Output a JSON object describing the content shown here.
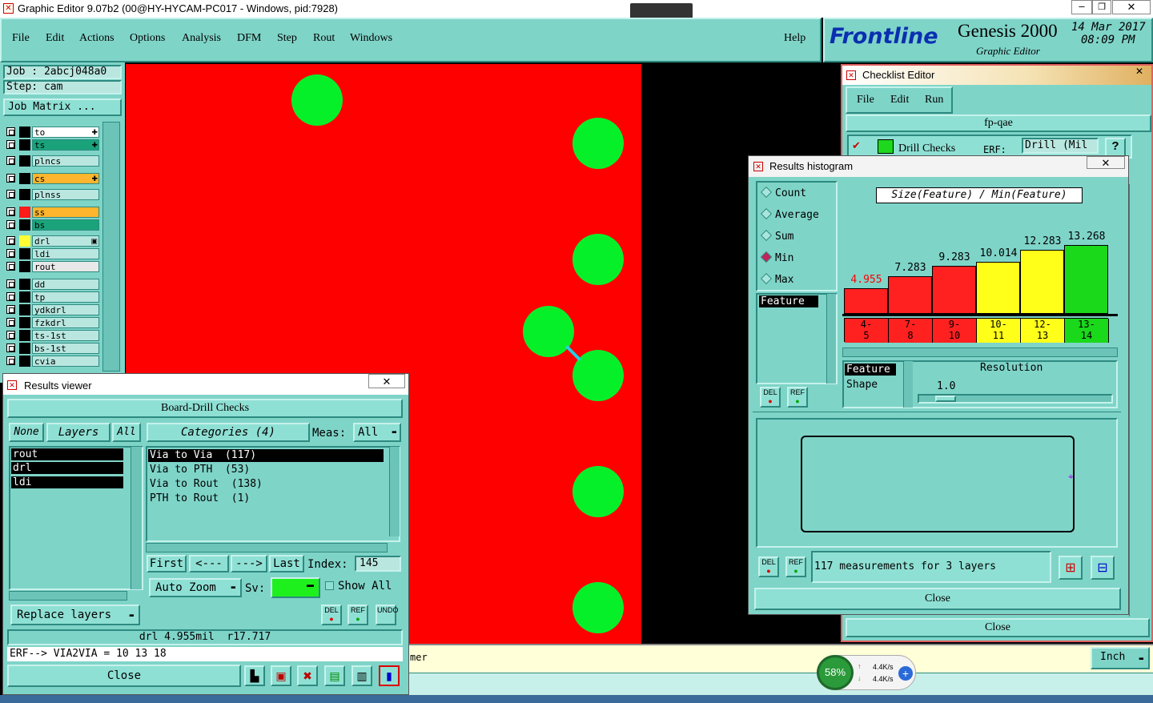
{
  "window": {
    "title": "Graphic Editor 9.07b2 (00@HY-HYCAM-PC017 - Windows, pid:7928)"
  },
  "menu": {
    "items": [
      "File",
      "Edit",
      "Actions",
      "Options",
      "Analysis",
      "DFM",
      "Step",
      "Rout",
      "Windows"
    ],
    "help": "Help"
  },
  "brand": {
    "logo": "Frontline",
    "product": "Genesis 2000",
    "subtitle": "Graphic Editor",
    "date": "14 Mar 2017",
    "time": "08:09 PM"
  },
  "job": {
    "job_label": "Job : 2abcj048a0",
    "step_label": "Step: cam",
    "matrix_button": "Job Matrix ..."
  },
  "layers": [
    {
      "name": "to",
      "color": "#000000",
      "name_bg": "#ffffff",
      "mark": "✚"
    },
    {
      "name": "ts",
      "color": "#000000",
      "name_bg": "#1aa37a",
      "mark": "✚"
    },
    {
      "name": "plncs",
      "color": "#000000",
      "name_bg": "#b9e7e0",
      "mark": ""
    },
    {
      "name": "cs",
      "color": "#000000",
      "name_bg": "#ffb52e",
      "mark": "✚"
    },
    {
      "name": "plnss",
      "color": "#000000",
      "name_bg": "#b9e7e0",
      "mark": ""
    },
    {
      "name": "ss",
      "color": "#ff1a1a",
      "name_bg": "#ffb52e",
      "mark": ""
    },
    {
      "name": "bs",
      "color": "#000000",
      "name_bg": "#1aa37a",
      "mark": ""
    },
    {
      "name": "drl",
      "color": "#ffff33",
      "name_bg": "#b9e7e0",
      "mark": "▣"
    },
    {
      "name": "ldi",
      "color": "#000000",
      "name_bg": "#b9e7e0",
      "mark": ""
    },
    {
      "name": "rout",
      "color": "#000000",
      "name_bg": "#e8e8e8",
      "mark": ""
    },
    {
      "name": "dd",
      "color": "#000000",
      "name_bg": "#b9e7e0",
      "mark": ""
    },
    {
      "name": "tp",
      "color": "#000000",
      "name_bg": "#b9e7e0",
      "mark": ""
    },
    {
      "name": "ydkdrl",
      "color": "#000000",
      "name_bg": "#b9e7e0",
      "mark": ""
    },
    {
      "name": "fzkdrl",
      "color": "#000000",
      "name_bg": "#b9e7e0",
      "mark": ""
    },
    {
      "name": "ts-1st",
      "color": "#000000",
      "name_bg": "#b9e7e0",
      "mark": ""
    },
    {
      "name": "bs-1st",
      "color": "#000000",
      "name_bg": "#b9e7e0",
      "mark": ""
    },
    {
      "name": "cvia",
      "color": "#000000",
      "name_bg": "#b9e7e0",
      "mark": ""
    }
  ],
  "results_viewer": {
    "title": "Results viewer",
    "header": "Board-Drill Checks",
    "btn_none": "None",
    "btn_layers": "Layers",
    "btn_all": "All",
    "btn_categories": "Categories (4)",
    "meas_label": "Meas:",
    "meas_value": "All",
    "layer_list": [
      "rout",
      "drl",
      "ldi"
    ],
    "categories": [
      "Via to Via  (117)",
      "Via to PTH  (53)",
      "Via to Rout  (138)",
      "PTH to Rout  (1)"
    ],
    "nav": {
      "first": "First",
      "prev": "<---",
      "next": "--->",
      "last": "Last",
      "index_label": "Index:",
      "index_value": "145"
    },
    "auto_zoom": "Auto Zoom",
    "sv_label": "Sv:",
    "show_all": "Show All",
    "replace_layers": "Replace layers",
    "status": "drl 4.955mil  r17.717",
    "erf": "ERF--> VIA2VIA = 10 13 18",
    "close": "Close",
    "icons": {
      "del": "DEL",
      "ref": "REF",
      "undo": "UNDO"
    }
  },
  "checklist_editor": {
    "title": "Checklist Editor",
    "menu": [
      "File",
      "Edit",
      "Run"
    ],
    "name": "fp-qae",
    "row_label": "Drill Checks",
    "erf_label": "ERF:",
    "erf_value": "Drill (Mil",
    "help": "?",
    "close": "Close"
  },
  "histogram": {
    "title": "Results histogram",
    "modes": [
      {
        "label": "Count",
        "selected": false
      },
      {
        "label": "Average",
        "selected": false
      },
      {
        "label": "Sum",
        "selected": false
      },
      {
        "label": "Min",
        "selected": true
      },
      {
        "label": "Max",
        "selected": false
      }
    ],
    "list_header": "Feature",
    "heading": "Size(Feature) / Min(Feature)",
    "bars": [
      {
        "value": "4.955",
        "category": "4-\n5",
        "color": "#ff2020",
        "cat_color": "#ff2020",
        "label_color": "#ff0000"
      },
      {
        "value": "7.283",
        "category": "7-\n8",
        "color": "#ff2020",
        "cat_color": "#ff2020",
        "label_color": "#000000"
      },
      {
        "value": "9.283",
        "category": "9-\n10",
        "color": "#ff2020",
        "cat_color": "#ff2020",
        "label_color": "#000000"
      },
      {
        "value": "10.014",
        "category": "10-\n11",
        "color": "#ffff1a",
        "cat_color": "#ffff1a",
        "label_color": "#000000"
      },
      {
        "value": "12.283",
        "category": "12-\n13",
        "color": "#ffff1a",
        "cat_color": "#ffff1a",
        "label_color": "#000000"
      },
      {
        "value": "13.268",
        "category": "13-\n14",
        "color": "#1ad81a",
        "cat_color": "#1ad81a",
        "label_color": "#000000"
      }
    ],
    "feature_label": "Feature",
    "shape_label": "Shape",
    "resolution_label": "Resolution",
    "resolution_value": "1.0",
    "measurements": "117 measurements for 3 layers",
    "close": "Close",
    "icons": {
      "del": "DEL",
      "ref": "REF"
    }
  },
  "bottom": {
    "status_fragment": "mer",
    "units": "Inch"
  },
  "network": {
    "percent": "58%",
    "up": "4.4K/s",
    "down": "4.4K/s"
  }
}
